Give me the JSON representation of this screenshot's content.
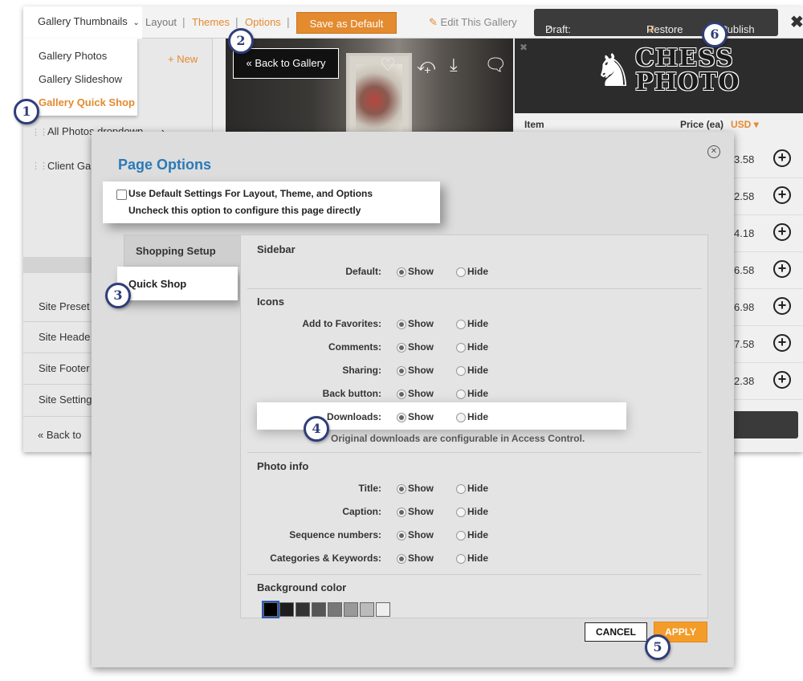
{
  "topbar": {
    "gallery_menu": "Gallery Thumbnails",
    "layout": "Layout",
    "themes": "Themes",
    "options": "Options",
    "save_default": "Save as Default",
    "edit_gallery": "Edit This Gallery",
    "draft_preview": "Draft: Preview",
    "restore": "Restore",
    "publish": "Publish"
  },
  "dropdown": {
    "items": [
      "Gallery Photos",
      "Gallery Slideshow",
      "Gallery Quick Shop"
    ]
  },
  "left_panel": {
    "new_label": "New",
    "rows": [
      "All Photos dropdown...",
      "Client Ga"
    ],
    "site_items": [
      "Site Preset",
      "Site Heade",
      "Site Footer",
      "Site Setting"
    ],
    "back_label": "Back to"
  },
  "gallery": {
    "back_label": "Back to Gallery"
  },
  "cart": {
    "logo_line1": "CHESS",
    "logo_line2": "PHOTO",
    "item_header": "Item",
    "price_header": "Price (ea)",
    "currency": "USD",
    "prices": [
      "3.58",
      "2.58",
      "4.18",
      "6.58",
      "6.98",
      "7.58",
      "2.38"
    ]
  },
  "modal": {
    "title": "Page Options",
    "use_default_line1": "Use Default Settings For Layout, Theme, and Options",
    "use_default_line2": "Uncheck this option to configure this page directly",
    "tabs": [
      "Shopping Setup",
      "Quick Shop"
    ],
    "show": "Show",
    "hide": "Hide",
    "sections": {
      "sidebar": {
        "title": "Sidebar",
        "options": [
          {
            "label": "Default:",
            "value": "Show"
          }
        ]
      },
      "icons": {
        "title": "Icons",
        "options": [
          {
            "label": "Add to Favorites:",
            "value": "Show"
          },
          {
            "label": "Comments:",
            "value": "Show"
          },
          {
            "label": "Sharing:",
            "value": "Show"
          },
          {
            "label": "Back button:",
            "value": "Show"
          },
          {
            "label": "Downloads:",
            "value": "Show"
          }
        ],
        "downloads_note": "Original downloads are configurable in Access Control."
      },
      "photo_info": {
        "title": "Photo info",
        "options": [
          {
            "label": "Title:",
            "value": "Show"
          },
          {
            "label": "Caption:",
            "value": "Show"
          },
          {
            "label": "Sequence numbers:",
            "value": "Show"
          },
          {
            "label": "Categories & Keywords:",
            "value": "Show"
          }
        ]
      },
      "background": {
        "title": "Background color",
        "swatches": [
          "#000000",
          "#1e1e1e",
          "#333333",
          "#555555",
          "#777777",
          "#999999",
          "#bbbbbb",
          "#eeeeee"
        ]
      }
    },
    "cancel": "CANCEL",
    "apply": "APPLY"
  },
  "callouts": [
    "1",
    "2",
    "3",
    "4",
    "5",
    "6"
  ],
  "colors": {
    "accent_orange": "#e48a2f",
    "title_blue": "#2a7ab8",
    "badge_navy": "#2f3e7a"
  }
}
